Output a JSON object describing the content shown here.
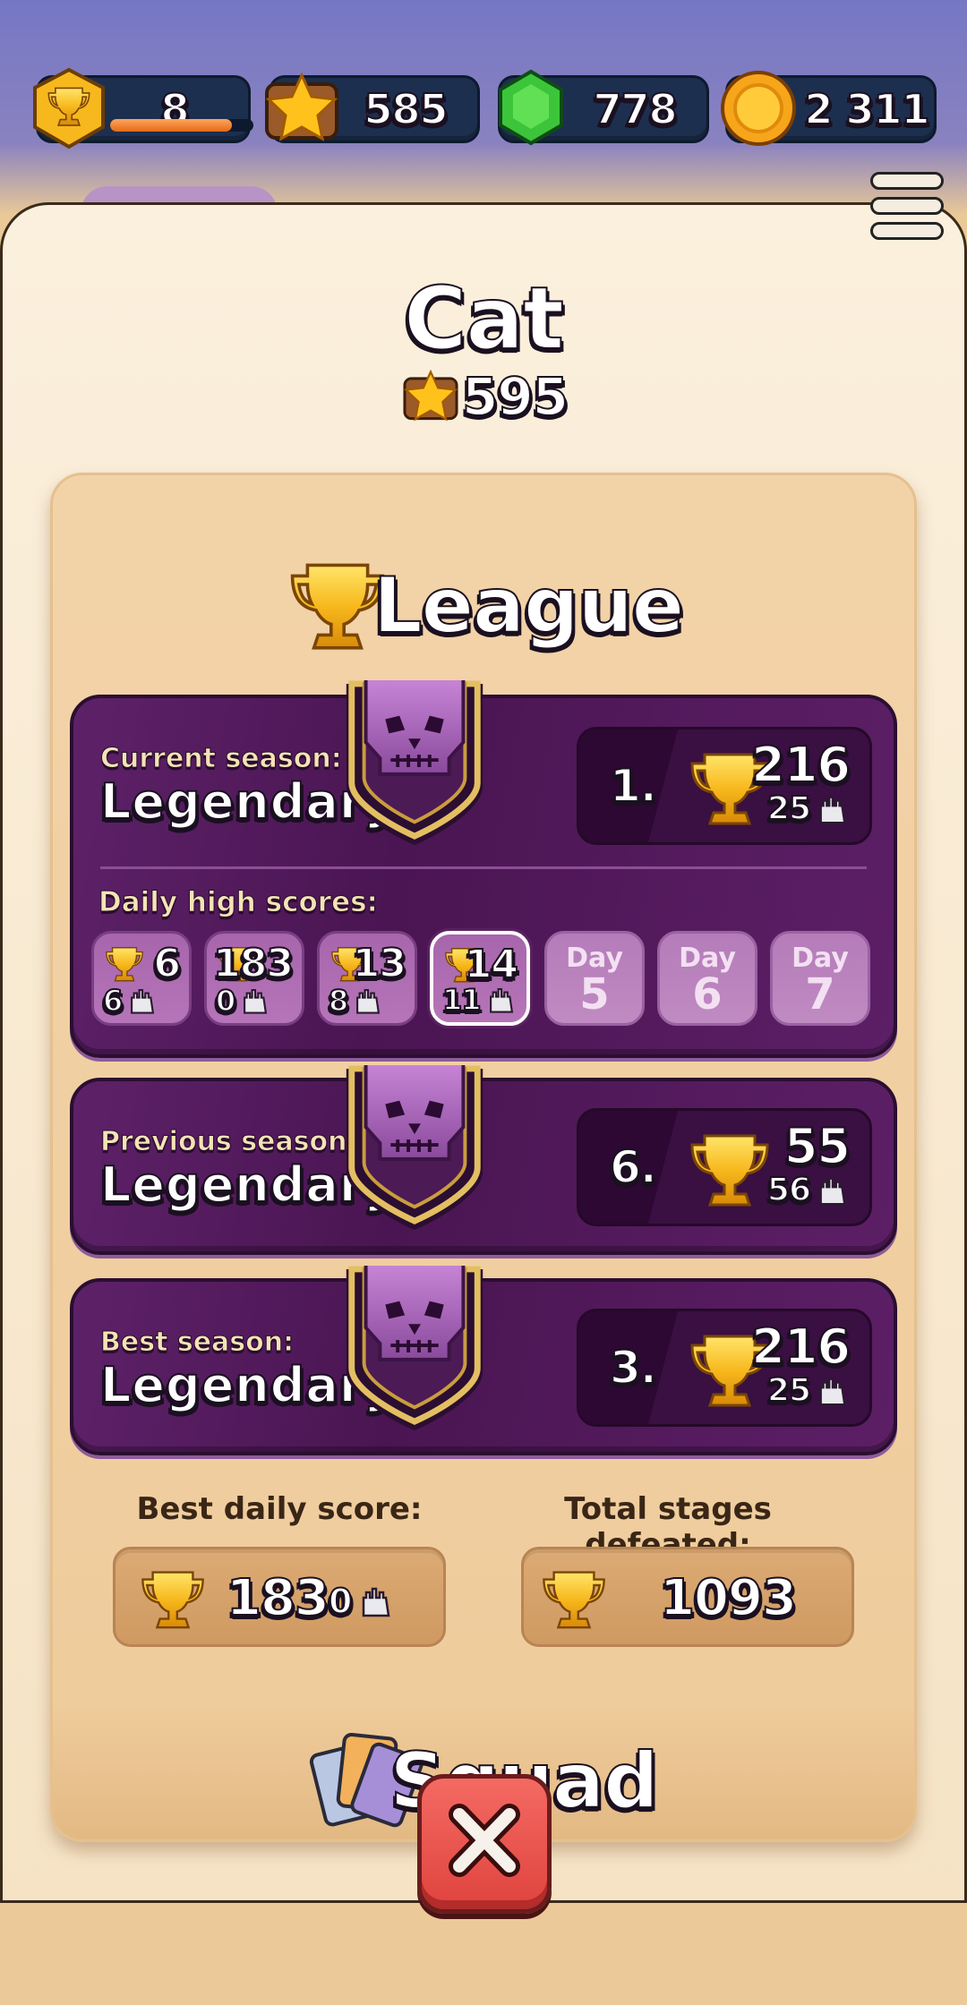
{
  "currencies": {
    "trophies": {
      "value": "8",
      "progress": 0.85
    },
    "stars": {
      "value": "585"
    },
    "gems": {
      "value": "778"
    },
    "coins": {
      "value": "2 311"
    }
  },
  "profile": {
    "name": "Cat",
    "xp": "595"
  },
  "league": {
    "title": "League",
    "current": {
      "label": "Current season:",
      "rank": "Legendary I",
      "position": "1.",
      "cups": "216",
      "stages": "25"
    },
    "daily": {
      "label": "Daily high scores:",
      "days": [
        {
          "cups": "6",
          "stages": "6"
        },
        {
          "cups": "183",
          "stages": "0"
        },
        {
          "cups": "13",
          "stages": "8"
        },
        {
          "cups": "14",
          "stages": "11"
        }
      ],
      "locked": [
        {
          "label": "Day",
          "num": "5"
        },
        {
          "label": "Day",
          "num": "6"
        },
        {
          "label": "Day",
          "num": "7"
        }
      ]
    },
    "previous": {
      "label": "Previous season:",
      "rank": "Legendary I",
      "position": "6.",
      "cups": "55",
      "stages": "56"
    },
    "best": {
      "label": "Best season:",
      "rank": "Legendary I",
      "position": "3.",
      "cups": "216",
      "stages": "25"
    },
    "best_daily": {
      "label": "Best daily score:",
      "cups": "183",
      "stages": "0"
    },
    "total_stages": {
      "label": "Total stages defeated:",
      "value": "1093"
    }
  },
  "squad": {
    "title": "Squad"
  }
}
